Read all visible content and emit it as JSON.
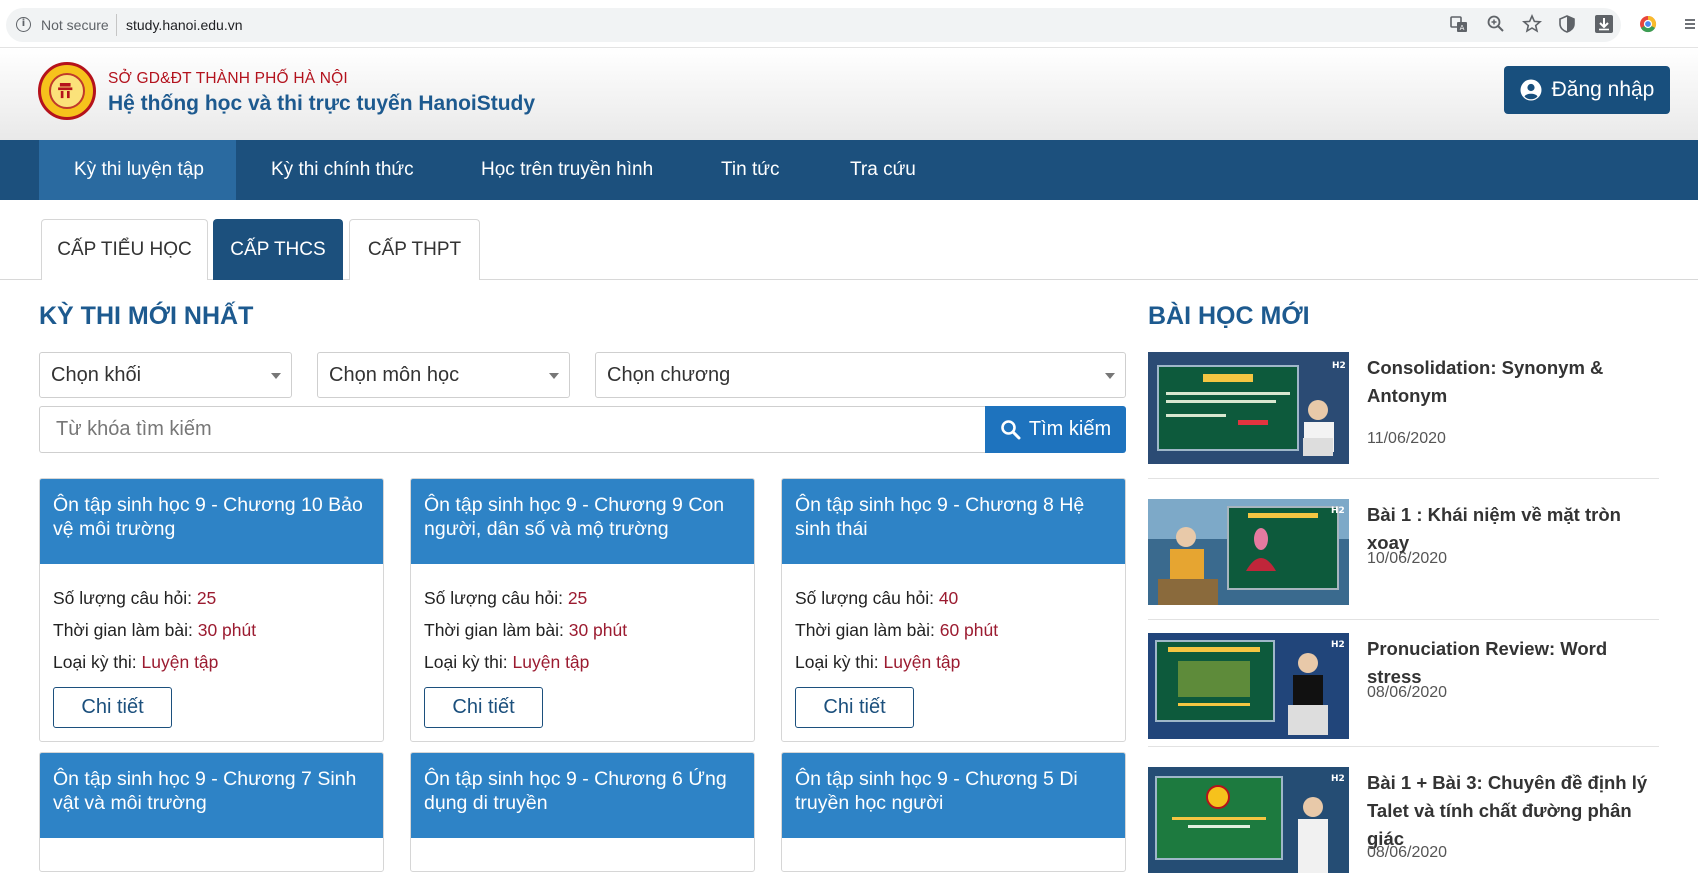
{
  "browser": {
    "security_label": "Not secure",
    "url": "study.hanoi.edu.vn"
  },
  "header": {
    "org_name": "SỞ GD&ĐT THÀNH PHỐ HÀ NỘI",
    "site_title": "Hệ thống học và thi trực tuyến HanoiStudy",
    "login_label": "Đăng nhập"
  },
  "nav": {
    "items": [
      {
        "label": "Kỳ thi luyện tập",
        "active": true
      },
      {
        "label": "Kỳ thi chính thức"
      },
      {
        "label": "Học trên truyền hình"
      },
      {
        "label": "Tin tức"
      },
      {
        "label": "Tra cứu"
      }
    ]
  },
  "level_tabs": [
    {
      "label": "CẤP TIỂU HỌC"
    },
    {
      "label": "CẤP THCS",
      "active": true
    },
    {
      "label": "CẤP THPT"
    }
  ],
  "exams_section": {
    "title": "KỲ THI MỚI NHẤT",
    "filters": {
      "grade": "Chọn khối",
      "subject": "Chọn môn học",
      "chapter": "Chọn chương"
    },
    "search": {
      "placeholder": "Từ khóa tìm kiếm",
      "button_label": "Tìm kiếm"
    },
    "labels": {
      "question_count": "Số lượng câu hỏi: ",
      "duration": "Thời gian làm bài: ",
      "exam_type": "Loại kỳ thi: ",
      "detail_button": "Chi tiết"
    },
    "cards": [
      {
        "title": "Ôn tập sinh học 9 - Chương 10 Bảo vệ môi trường",
        "questions": "25",
        "duration": "30 phút",
        "type": "Luyện tập"
      },
      {
        "title": "Ôn tập sinh học 9 - Chương 9 Con người, dân số và mộ trường",
        "questions": "25",
        "duration": "30 phút",
        "type": "Luyện tập"
      },
      {
        "title": "Ôn tập sinh học 9 - Chương 8 Hệ sinh thái",
        "questions": "40",
        "duration": "60 phút",
        "type": "Luyện tập"
      },
      {
        "title": "Ôn tập sinh học 9 - Chương 7 Sinh vật và môi trường"
      },
      {
        "title": "Ôn tập sinh học 9 - Chương 6 Ứng dụng di truyền"
      },
      {
        "title": "Ôn tập sinh học 9 - Chương 5 Di truyền học người"
      }
    ]
  },
  "lessons_section": {
    "title": "BÀI HỌC MỚI",
    "items": [
      {
        "title": "Consolidation: Synonym & Antonym",
        "date": "11/06/2020",
        "thumb_text": "Example"
      },
      {
        "title": "Bài 1 : Khái niệm về mặt tròn xoay",
        "date": "10/06/2020",
        "thumb_text": "CHỦ ĐỀ: MẶT TRÒN XOAY"
      },
      {
        "title": "Pronuciation Review: Word stress",
        "date": "08/06/2020",
        "thumb_text": "PRONUNCIATION REVIEW"
      },
      {
        "title": "Bài 1 + Bài 3: Chuyên đề định lý Talet và tính chất đường phân giác",
        "date": "08/06/2020",
        "thumb_text": "MÔN TOÁN 8"
      }
    ]
  },
  "colors": {
    "brand_dark": "#1c507d",
    "brand_blue": "#2e83c6",
    "value_red": "#9b1b30",
    "org_red": "#b3121d"
  }
}
